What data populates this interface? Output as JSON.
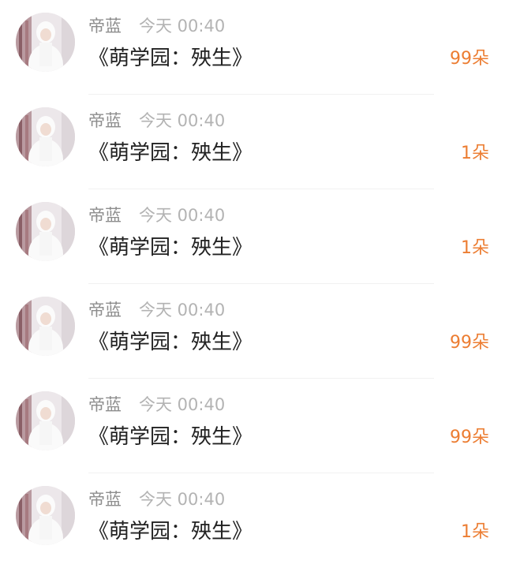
{
  "messages": [
    {
      "sender": "帝蓝",
      "time": "今天 00:40",
      "title": "《萌学园：殃生》",
      "gift": "99朵",
      "avatar_icon": "user-avatar"
    },
    {
      "sender": "帝蓝",
      "time": "今天 00:40",
      "title": "《萌学园：殃生》",
      "gift": "1朵",
      "avatar_icon": "user-avatar"
    },
    {
      "sender": "帝蓝",
      "time": "今天 00:40",
      "title": "《萌学园：殃生》",
      "gift": "1朵",
      "avatar_icon": "user-avatar"
    },
    {
      "sender": "帝蓝",
      "time": "今天 00:40",
      "title": "《萌学园：殃生》",
      "gift": "99朵",
      "avatar_icon": "user-avatar"
    },
    {
      "sender": "帝蓝",
      "time": "今天 00:40",
      "title": "《萌学园：殃生》",
      "gift": "99朵",
      "avatar_icon": "user-avatar"
    },
    {
      "sender": "帝蓝",
      "time": "今天 00:40",
      "title": "《萌学园：殃生》",
      "gift": "1朵",
      "avatar_icon": "user-avatar"
    }
  ],
  "colors": {
    "gift_accent": "#ec7d32",
    "sender_name": "#8d8d8d",
    "timestamp": "#b3b3b3",
    "title_text": "#222222"
  }
}
